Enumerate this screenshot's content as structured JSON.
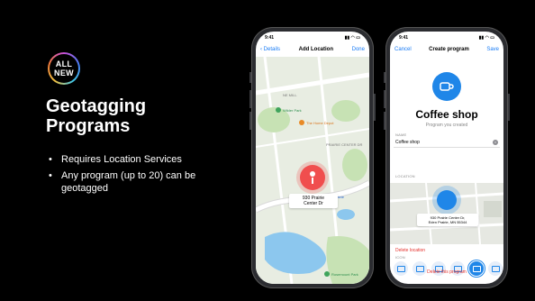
{
  "badge": {
    "line1": "ALL",
    "line2": "NEW"
  },
  "headline": {
    "line1": "Geotagging",
    "line2": "Programs"
  },
  "bullets": [
    "Requires Location Services",
    "Any program (up to 20) can be geotagged"
  ],
  "phone1": {
    "time": "9:41",
    "nav": {
      "back": "Details",
      "title": "Add Location",
      "action": "Done"
    },
    "address": {
      "line1": "930 Prairie",
      "line2": "Center Dr"
    },
    "pois": [
      "Wilder Park",
      "The Home Depot",
      "Eden Prairie",
      "Rosemount Park"
    ],
    "roads": [
      "PRAIRIE CENTER DR",
      "NE MILL"
    ]
  },
  "phone2": {
    "time": "9:41",
    "nav": {
      "cancel": "Cancel",
      "title": "Create program",
      "save": "Save"
    },
    "program_name": "Coffee shop",
    "program_sub": "Program you created",
    "name_label": "NAME",
    "name_value": "Coffee shop",
    "location_label": "LOCATION",
    "address": {
      "line1": "930 Prairie Center Dr,",
      "line2": "Eden Prairie, MN 55344"
    },
    "delete_location": "Delete location",
    "icon_label": "ICON",
    "delete_program": "Delete this program"
  },
  "colors": {
    "accent": "#1f86e8",
    "pin": "#f04e4e",
    "destructive": "#e5322d"
  }
}
